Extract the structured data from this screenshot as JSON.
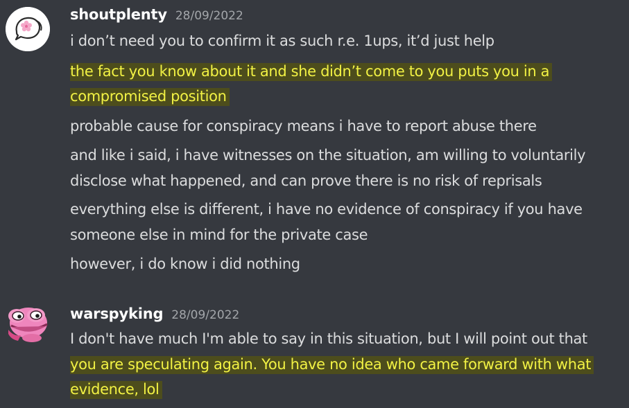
{
  "messages": [
    {
      "username": "shoutplenty",
      "timestamp": "28/09/2022",
      "avatar_icon": "flower-speech-bubble-icon",
      "lines": [
        "i don’t need you to confirm it as such r.e. 1ups, it’d just help",
        "the fact you know about it and she didn’t come to you puts you in a",
        "compromised position",
        "probable cause for conspiracy means i have to report abuse there",
        "and like i said, i have witnesses on the situation, am willing to voluntarily",
        "disclose what happened, and can prove there is no risk of reprisals",
        "everything else is different, i have no evidence of conspiracy if you have",
        "someone else in mind for the private case",
        "however, i do know i did nothing"
      ]
    },
    {
      "username": "warspyking",
      "timestamp": "28/09/2022",
      "avatar_icon": "pink-frog-icon",
      "lines": [
        "I don't have much I'm able to say in this situation, but I will point out that",
        "you are speculating again. You have no idea who came forward with what",
        "evidence, lol"
      ]
    }
  ],
  "colors": {
    "background": "#36393f",
    "text": "#dcddde",
    "username": "#ffffff",
    "timestamp": "#a3a6aa",
    "highlight_bg": "#4d4d1c",
    "highlight_text": "#f2f244"
  }
}
